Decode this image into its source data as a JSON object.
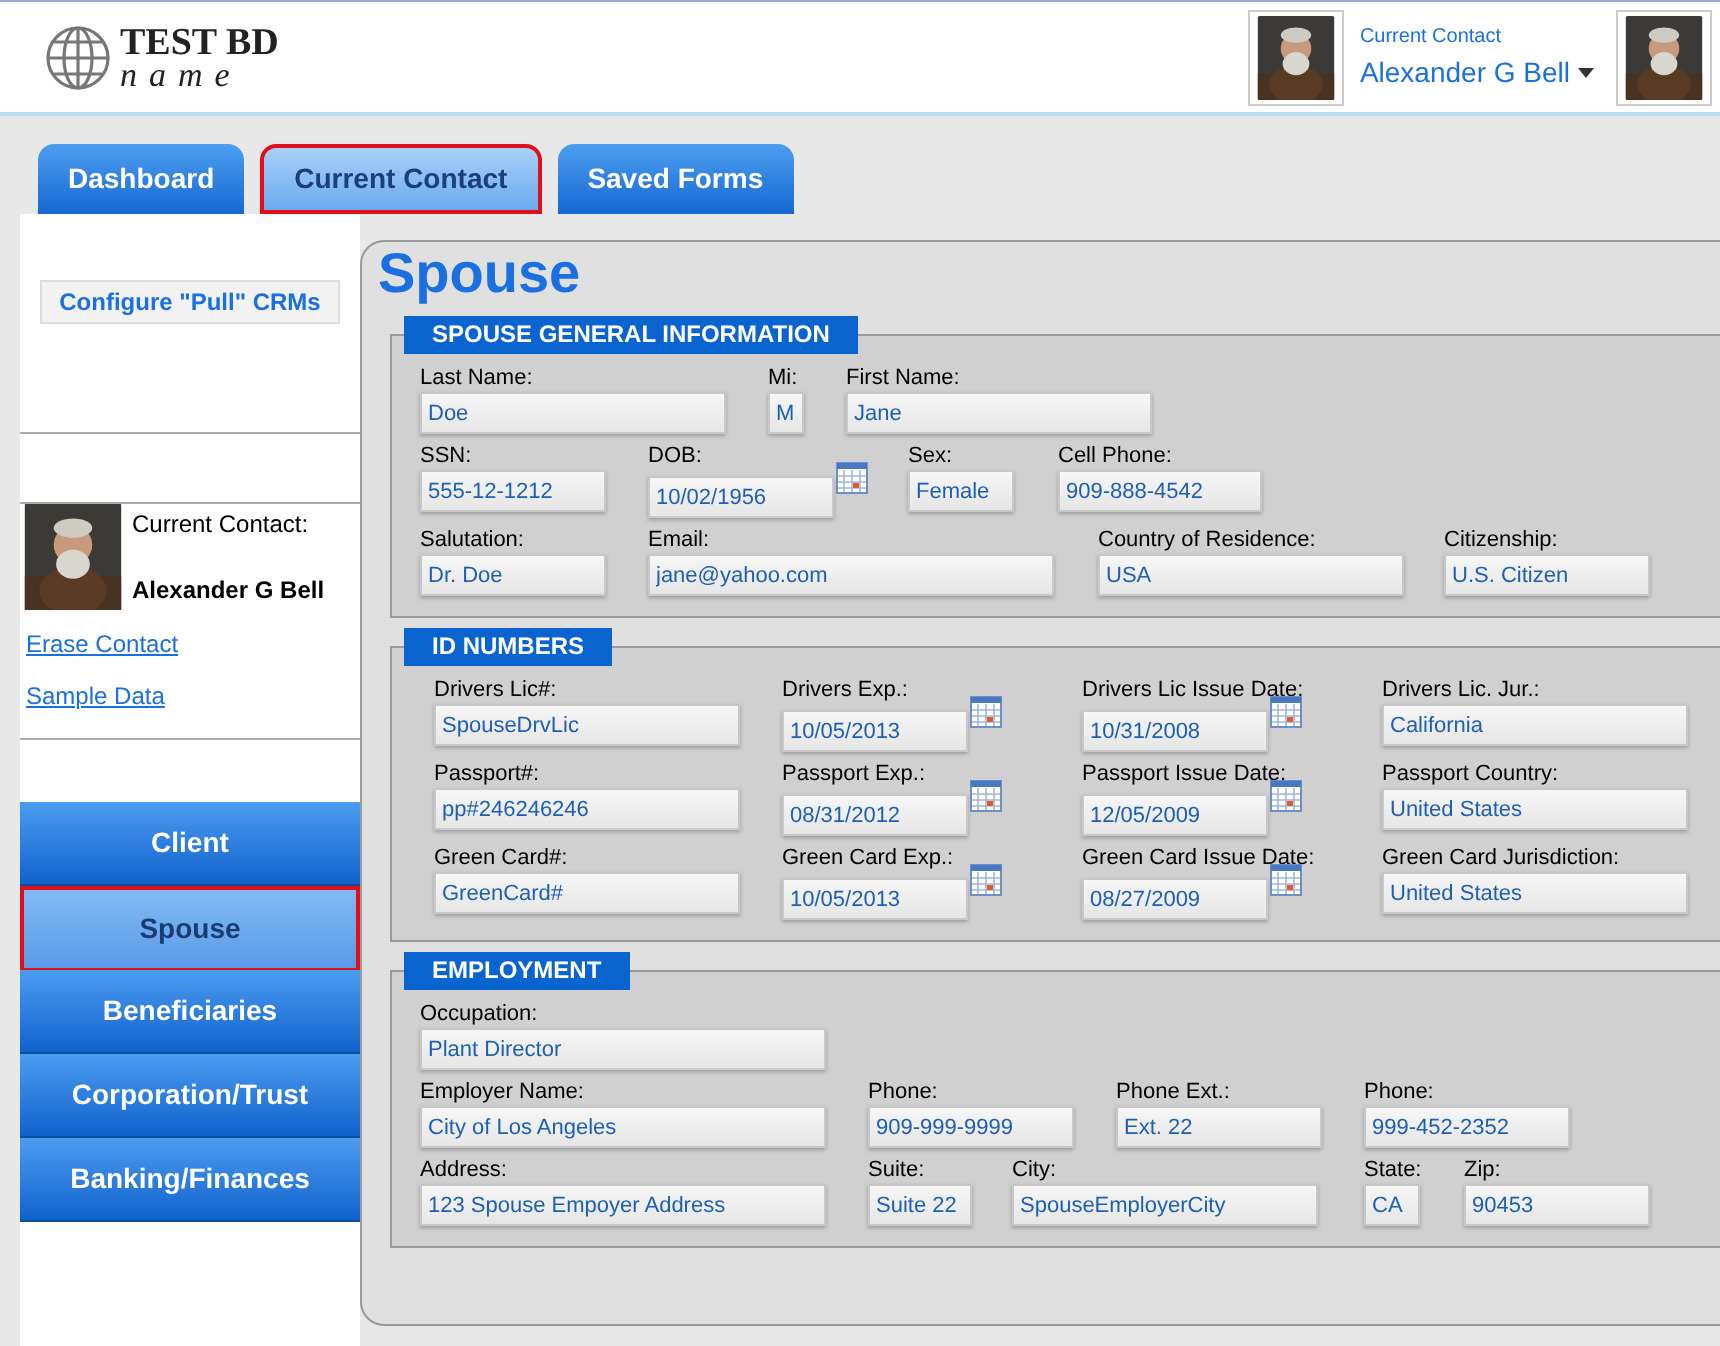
{
  "header": {
    "logo_line1": "TEST BD",
    "logo_line2": "name",
    "contact_caption": "Current Contact",
    "contact_name": "Alexander G Bell"
  },
  "tabs": [
    {
      "label": "Dashboard",
      "selected": false
    },
    {
      "label": "Current Contact",
      "selected": true
    },
    {
      "label": "Saved Forms",
      "selected": false
    }
  ],
  "sidebar": {
    "configure_button": "Configure \"Pull\" CRMs",
    "contact_label": "Current Contact:",
    "contact_name": "Alexander G Bell",
    "links": [
      "Erase Contact",
      "Sample Data"
    ],
    "nav": [
      {
        "label": "Client",
        "selected": false
      },
      {
        "label": "Spouse",
        "selected": true
      },
      {
        "label": "Beneficiaries",
        "selected": false
      },
      {
        "label": "Corporation/Trust",
        "selected": false
      },
      {
        "label": "Banking/Finances",
        "selected": false
      }
    ]
  },
  "page_title": "Spouse",
  "sections": [
    {
      "title": "SPOUSE GENERAL INFORMATION",
      "fields": [
        {
          "label": "Last Name:",
          "value": "Doe",
          "kind": "text"
        },
        {
          "label": "Mi:",
          "value": "M",
          "kind": "text"
        },
        {
          "label": "First Name:",
          "value": "Jane",
          "kind": "text"
        },
        {
          "label": "SSN:",
          "value": "555-12-1212",
          "kind": "text"
        },
        {
          "label": "DOB:",
          "value": "10/02/1956",
          "kind": "date"
        },
        {
          "label": "Sex:",
          "value": "Female",
          "kind": "text"
        },
        {
          "label": "Cell Phone:",
          "value": "909-888-4542",
          "kind": "text"
        },
        {
          "label": "Salutation:",
          "value": "Dr. Doe",
          "kind": "text"
        },
        {
          "label": "Email:",
          "value": "jane@yahoo.com",
          "kind": "text"
        },
        {
          "label": "Country of Residence:",
          "value": "USA",
          "kind": "text"
        },
        {
          "label": "Citizenship:",
          "value": "U.S. Citizen",
          "kind": "text"
        }
      ]
    },
    {
      "title": "ID NUMBERS",
      "fields": [
        {
          "label": "Drivers Lic#:",
          "value": "SpouseDrvLic",
          "kind": "text"
        },
        {
          "label": "Drivers Exp.:",
          "value": "10/05/2013",
          "kind": "date"
        },
        {
          "label": "Drivers Lic Issue Date:",
          "value": "10/31/2008",
          "kind": "date"
        },
        {
          "label": "Drivers Lic. Jur.:",
          "value": "California",
          "kind": "text"
        },
        {
          "label": "Passport#:",
          "value": "pp#246246246",
          "kind": "text"
        },
        {
          "label": "Passport Exp.:",
          "value": "08/31/2012",
          "kind": "date"
        },
        {
          "label": "Passport Issue Date:",
          "value": "12/05/2009",
          "kind": "date"
        },
        {
          "label": "Passport Country:",
          "value": "United States",
          "kind": "text"
        },
        {
          "label": "Green Card#:",
          "value": "GreenCard#",
          "kind": "text"
        },
        {
          "label": "Green Card Exp.:",
          "value": "10/05/2013",
          "kind": "date"
        },
        {
          "label": "Green Card Issue Date:",
          "value": "08/27/2009",
          "kind": "date"
        },
        {
          "label": "Green Card Jurisdiction:",
          "value": "United States",
          "kind": "text"
        }
      ]
    },
    {
      "title": "EMPLOYMENT",
      "fields": [
        {
          "label": "Occupation:",
          "value": "Plant Director",
          "kind": "text"
        },
        {
          "label": "Employer Name:",
          "value": "City of Los Angeles",
          "kind": "text"
        },
        {
          "label": "Phone:",
          "value": "909-999-9999",
          "kind": "text"
        },
        {
          "label": "Phone Ext.:",
          "value": "Ext. 22",
          "kind": "text"
        },
        {
          "label": "Phone:",
          "value": "999-452-2352",
          "kind": "text"
        },
        {
          "label": "Address:",
          "value": "123 Spouse Empoyer Address",
          "kind": "text"
        },
        {
          "label": "Suite:",
          "value": "Suite 22",
          "kind": "text"
        },
        {
          "label": "City:",
          "value": "SpouseEmployerCity",
          "kind": "text"
        },
        {
          "label": "State:",
          "value": "CA",
          "kind": "text"
        },
        {
          "label": "Zip:",
          "value": "90453",
          "kind": "text"
        }
      ]
    }
  ]
}
